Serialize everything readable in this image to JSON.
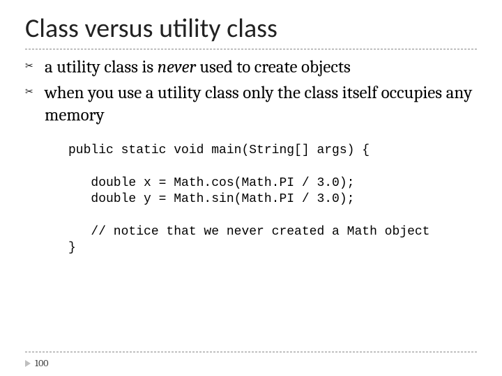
{
  "title": "Class versus utility class",
  "bullets": [
    {
      "pre": "a utility class is ",
      "em": "never",
      "post": " used to create objects"
    },
    {
      "pre": "when you use a utility class only the class itself occupies any memory",
      "em": "",
      "post": ""
    }
  ],
  "code": {
    "l1": "public static void main(String[] args) {",
    "l2": "   double x = Math.cos(Math.PI / 3.0);",
    "l3": "   double y = Math.sin(Math.PI / 3.0);",
    "l4": "   // notice that we never created a Math object",
    "l5": "}"
  },
  "page_number": "100"
}
